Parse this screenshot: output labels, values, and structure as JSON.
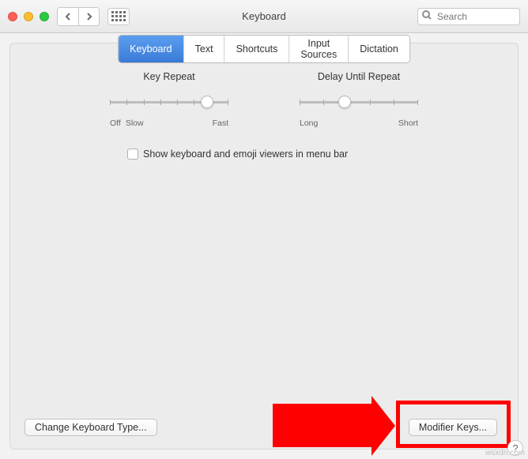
{
  "window": {
    "title": "Keyboard"
  },
  "search": {
    "placeholder": "Search"
  },
  "tabs": [
    {
      "label": "Keyboard",
      "active": true
    },
    {
      "label": "Text",
      "active": false
    },
    {
      "label": "Shortcuts",
      "active": false
    },
    {
      "label": "Input Sources",
      "active": false
    },
    {
      "label": "Dictation",
      "active": false
    }
  ],
  "sliders": {
    "key_repeat": {
      "title": "Key Repeat",
      "left_extra": "Off",
      "left": "Slow",
      "right": "Fast",
      "value_pct": 82
    },
    "delay": {
      "title": "Delay Until Repeat",
      "left": "Long",
      "right": "Short",
      "value_pct": 38
    }
  },
  "checkbox": {
    "label": "Show keyboard and emoji viewers in menu bar",
    "checked": false
  },
  "buttons": {
    "change_type": "Change Keyboard Type...",
    "modifier_keys": "Modifier Keys..."
  },
  "help": "?",
  "watermark": "wsxdn.com"
}
